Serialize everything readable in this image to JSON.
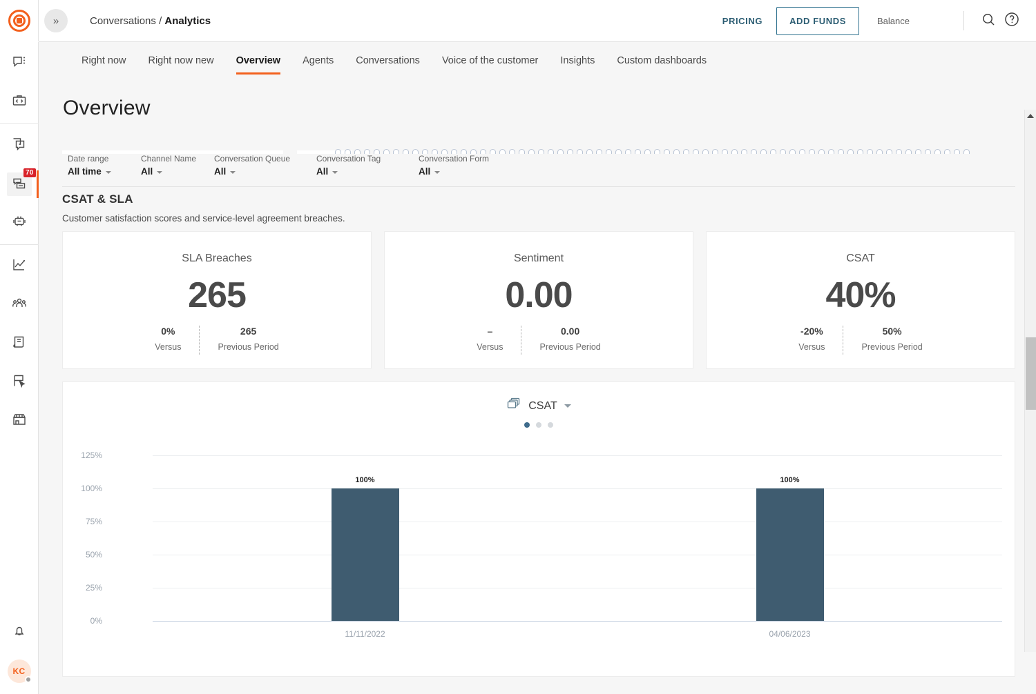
{
  "brand": {
    "logo_icon": "bullseye-logo-icon",
    "accent": "#f3601d"
  },
  "topbar": {
    "collapse_icon": "double-chevron-right-icon",
    "breadcrumb_root": "Conversations",
    "breadcrumb_sep": "/",
    "breadcrumb_current": "Analytics",
    "pricing_label": "PRICING",
    "add_funds_label": "ADD FUNDS",
    "balance_label": "Balance",
    "search_icon": "search-icon",
    "help_icon": "help-circle-icon"
  },
  "rail": {
    "top_items": [
      {
        "icon": "chat-bubble-menu-icon",
        "active": false
      },
      {
        "icon": "code-briefcase-icon",
        "active": false
      }
    ],
    "mid_items": [
      {
        "icon": "copy-chat-icon",
        "active": false,
        "badge": ""
      },
      {
        "icon": "inbox-tray-icon",
        "active": true,
        "badge": "70"
      },
      {
        "icon": "robot-icon",
        "active": false,
        "badge": ""
      }
    ],
    "low_items": [
      {
        "icon": "line-chart-icon",
        "active": false
      },
      {
        "icon": "people-group-icon",
        "active": false
      },
      {
        "icon": "book-reports-icon",
        "active": false
      },
      {
        "icon": "flag-cursor-icon",
        "active": false
      },
      {
        "icon": "storefront-icon",
        "active": false
      }
    ],
    "bell_icon": "bell-icon",
    "avatar_initials": "KC"
  },
  "tabs": [
    {
      "label": "Right now",
      "active": false
    },
    {
      "label": "Right now new",
      "active": false
    },
    {
      "label": "Overview",
      "active": true
    },
    {
      "label": "Agents",
      "active": false
    },
    {
      "label": "Conversations",
      "active": false
    },
    {
      "label": "Voice of the customer",
      "active": false
    },
    {
      "label": "Insights",
      "active": false
    },
    {
      "label": "Custom dashboards",
      "active": false
    }
  ],
  "page": {
    "title": "Overview"
  },
  "filters": [
    {
      "label": "Date range",
      "value": "All time"
    },
    {
      "label": "Channel Name",
      "value": "All"
    },
    {
      "label": "Conversation Queue",
      "value": "All"
    },
    {
      "label": "Conversation Tag",
      "value": "All"
    },
    {
      "label": "Conversation Form",
      "value": "All"
    }
  ],
  "section": {
    "title": "CSAT & SLA",
    "subtitle": "Customer satisfaction scores and service-level agreement breaches."
  },
  "cards": [
    {
      "title": "SLA Breaches",
      "value": "265",
      "delta": "0%",
      "delta_label": "Versus",
      "previous": "265",
      "previous_label": "Previous Period"
    },
    {
      "title": "Sentiment",
      "value": "0.00",
      "delta": "–",
      "delta_label": "Versus",
      "previous": "0.00",
      "previous_label": "Previous Period"
    },
    {
      "title": "CSAT",
      "value": "40%",
      "delta": "-20%",
      "delta_label": "Versus",
      "previous": "50%",
      "previous_label": "Previous Period"
    }
  ],
  "chart_panel": {
    "selector_icon": "layers-stack-icon",
    "selector_label": "CSAT",
    "selector_chevron_icon": "chevron-down-icon",
    "pagination_dots": [
      true,
      false,
      false
    ]
  },
  "chart_data": {
    "type": "bar",
    "title": "CSAT",
    "categories": [
      "11/11/2022",
      "04/06/2023"
    ],
    "values": [
      100,
      100
    ],
    "data_labels": [
      "100%",
      "100%"
    ],
    "xlabel": "",
    "ylabel": "",
    "ylim": [
      0,
      125
    ],
    "yticks": [
      0,
      25,
      50,
      75,
      100,
      125
    ],
    "ytick_labels": [
      "0%",
      "25%",
      "50%",
      "75%",
      "100%",
      "125%"
    ],
    "grid": true,
    "legend": false,
    "bar_color": "#3f5c70"
  },
  "scrollbar": {
    "up_arrow_icon": "triangle-up-icon"
  }
}
